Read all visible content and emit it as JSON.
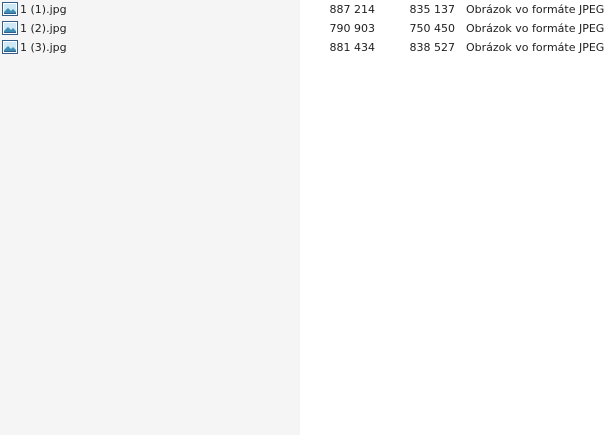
{
  "files": [
    {
      "name": "1 (1).jpg",
      "size": "887 214",
      "packed": "835 137",
      "type": "Obrázok vo formáte JPEG",
      "icon": "image-file-icon"
    },
    {
      "name": "1 (2).jpg",
      "size": "790 903",
      "packed": "750 450",
      "type": "Obrázok vo formáte JPEG",
      "icon": "image-file-icon"
    },
    {
      "name": "1 (3).jpg",
      "size": "881 434",
      "packed": "838 527",
      "type": "Obrázok vo formáte JPEG",
      "icon": "image-file-icon"
    }
  ],
  "colors": {
    "name_column_background": "#f5f5f5",
    "content_background": "#ffffff",
    "text": "#1e1e1e",
    "icon_frame": "#2f5f8a",
    "icon_sky": "#cfe8f5",
    "icon_land": "#3f8fb5"
  }
}
